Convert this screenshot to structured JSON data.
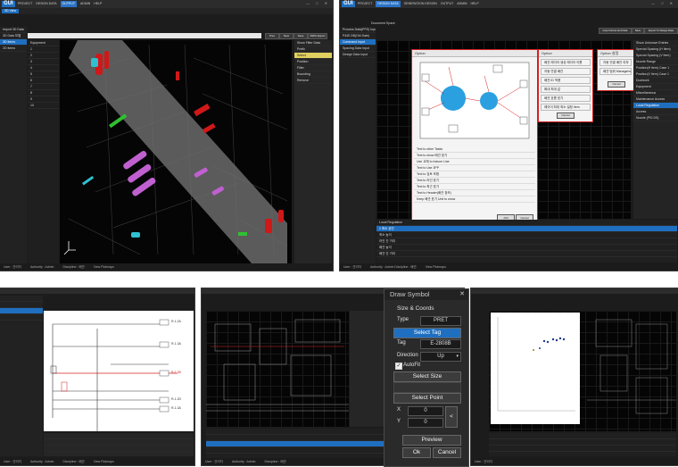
{
  "app": {
    "logo": "GUI",
    "menus": [
      "PROJECT",
      "DESIGN DATA",
      "OUTPUT",
      "ADMIN",
      "HELP"
    ],
    "menus_panel2": [
      "PROJECT",
      "DESIGN DATA",
      "GENERATION DESIGN",
      "OUTPUT",
      "ADMIN",
      "HELP"
    ],
    "window_buttons": "— □ ✕"
  },
  "panel1": {
    "subtab": "3D View",
    "left_items": [
      "Import 3D Data",
      "3D Data 모델",
      "3D Items",
      "2D Items"
    ],
    "tree_header": "Equipment",
    "tree_items": [
      "1",
      "2",
      "3",
      "4",
      "5",
      "6",
      "7",
      "8",
      "9",
      "10"
    ],
    "toolbar_buttons": [
      "Prev",
      "Next",
      "Save",
      "DWG Export"
    ],
    "right_header": "Show Filter Data",
    "right_fields": [
      "Prefix",
      "Select",
      "Position",
      "Filter",
      "Bounding",
      "Remove"
    ],
    "status": [
      "User : 관리자",
      "Authority : Admin",
      "Discipline : 배관",
      "View Plotmaps"
    ]
  },
  "panel2": {
    "subtab": "Document Space",
    "left_items": [
      "Process Data(PFD) Input",
      "P&ID DB(Old Date)",
      "Command Input",
      "Spacing Data Input",
      "Design Data Input"
    ],
    "dialog_title": "Option",
    "dialog_rows": [
      "Text to other Tasks",
      "Text to show 배관 표기",
      "Use 교체 to Induce Line",
      "Text to Use 3PP",
      "Text to 검토 포함",
      "Text to 라인 표기",
      "Text to 최근 표기",
      "Text to Header(배관 참조)",
      "Keep 배관 표기 Unit to show"
    ],
    "dialog_ok": "Add",
    "dialog_cancel": "Cancel",
    "option_title": "Option",
    "option_rows": [
      "배관 레이어 생성 레이어 이름",
      "자동 연결 배관",
      "배관 ID 적용",
      "확대 최대 값",
      "배관 흐름 표기",
      "레이어 최대 최소 설정 Item"
    ],
    "option_ok": "Cancel",
    "option2_title": "Option 설정",
    "option2_rows": [
      "자동 연결 배관 여부",
      "배관 범위 Management Area 설정"
    ],
    "option2_ok": "Cancel",
    "right_list_title": "Show Unknown Entries",
    "right_list": [
      "Special Spacing (H Item)",
      "Special Spacing (V Item)",
      "Nozzle Range",
      "Position(H Item) Case 1",
      "Position(V Item) Case 1",
      "Ductwork",
      "Equipment",
      "Miscellaneous",
      "Maintenance Access",
      "Local Regulation",
      "Access",
      "Nozzle (PSI DS)"
    ],
    "bottom_title": "Local Regulation",
    "bottom_rows": [
      "1 최소 공간",
      "최소 높이",
      "라인 간 거리",
      "배관 높이",
      "배관 간 거리",
      "단위 구분"
    ],
    "top_buttons": [
      "Import Excel and Data",
      "Save",
      "Export To Design Data"
    ],
    "status": [
      "User : 관리자",
      "Authority : Admin Discipline : 배관",
      "View Plotmaps"
    ]
  },
  "panel3": {
    "tags": [
      "R-1.2A",
      "R-1.3A",
      "R-1.2B",
      "R-1.2D",
      "R-1.3A"
    ],
    "status": [
      "User : 관리자",
      "Authority : Admin",
      "Discipline : 배관",
      "View Plotmaps"
    ]
  },
  "panel4": {
    "dialog_title": "Draw Symbol",
    "section_label": "Size & Coords",
    "type_label": "Type",
    "type_value": "PRET",
    "select_tag_label": "Select Tag",
    "tag_label": "Tag",
    "tag_value": "E-2808B",
    "direction_label": "Direction",
    "direction_value": "Up",
    "autofit_label": "AutoFit",
    "autofit_checked": true,
    "select_size_label": "Select Size",
    "select_point_label": "Select Point",
    "x_label": "X",
    "x_value": "0",
    "y_label": "Y",
    "y_value": "0",
    "arrow_label": "<",
    "preview_label": "Preview",
    "ok_label": "Ok",
    "cancel_label": "Cancel",
    "status": [
      "User : 관리자",
      "Authority : Admin",
      "Discipline : 배관"
    ]
  },
  "panel5": {
    "plot_title": "",
    "status": [
      "User : 관리자"
    ]
  },
  "colors": {
    "accent_blue": "#1f6fc0",
    "dialog_border_red": "#d42020",
    "canvas_bg": "#050505",
    "panel_bg": "#1c1c1c",
    "road_gray": "#6b6b6b",
    "pipe_red": "#d01818",
    "pipe_magenta": "#c060d0",
    "pipe_green": "#30c030",
    "pipe_cyan": "#30c0d0"
  }
}
